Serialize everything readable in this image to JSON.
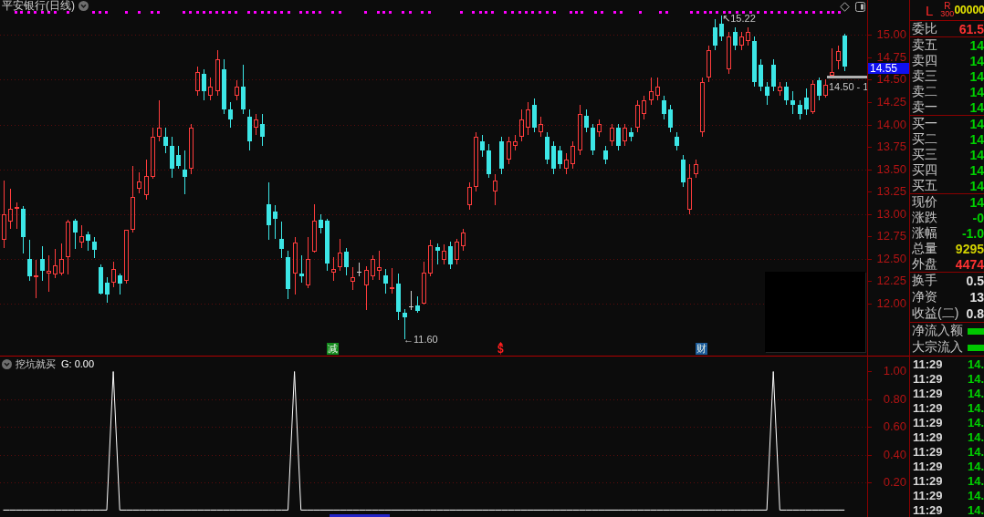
{
  "chart": {
    "title": "平安银行(日线)",
    "current_price": "14.55",
    "high_label": "↖15.22",
    "low_label": "←11.60",
    "price_line_label": "14.50 - 1",
    "event_markers": [
      {
        "kind": "badge",
        "label": "减",
        "color": "#138a1c"
      },
      {
        "kind": "glyph",
        "label": "$",
        "color": "#ff1e1e"
      },
      {
        "kind": "badge",
        "label": "财",
        "color": "#1d5c9a"
      }
    ],
    "chart_data": {
      "type": "candlestick",
      "grid": true,
      "ylim": [
        11.42,
        15.39
      ],
      "yticks": [
        {
          "value": 15,
          "label": "15.00"
        },
        {
          "value": 14.75,
          "label": "14.75"
        },
        {
          "value": 14.5,
          "label": "14.50"
        },
        {
          "value": 14.25,
          "label": "14.25"
        },
        {
          "value": 14,
          "label": "14.00"
        },
        {
          "value": 13.75,
          "label": "13.75"
        },
        {
          "value": 13.5,
          "label": "13.50"
        },
        {
          "value": 13.25,
          "label": "13.25"
        },
        {
          "value": 13,
          "label": "13.00"
        },
        {
          "value": 12.75,
          "label": "12.75"
        },
        {
          "value": 12.5,
          "label": "12.50"
        },
        {
          "value": 12.25,
          "label": "12.25"
        },
        {
          "value": 12,
          "label": "12.00"
        }
      ],
      "categories": [
        null,
        null,
        null,
        null,
        null,
        null,
        null,
        null,
        null,
        null,
        null,
        null,
        null,
        null,
        null,
        null,
        null,
        null,
        null,
        null,
        null,
        null,
        null,
        null,
        null,
        null,
        null,
        null,
        null,
        null,
        null,
        null,
        null,
        null,
        null,
        null,
        null,
        null,
        null,
        null,
        null,
        null,
        null,
        null,
        null,
        null,
        null,
        null,
        null,
        null,
        null,
        null,
        null,
        null,
        null,
        null,
        null,
        null,
        null,
        null,
        null,
        null,
        null,
        null,
        null,
        null,
        null,
        null,
        null,
        null,
        null,
        null,
        null,
        null,
        null,
        null,
        null,
        null,
        null,
        null,
        null,
        null,
        null,
        null,
        null,
        null,
        null,
        null,
        null,
        null,
        null,
        null,
        null,
        null,
        null,
        null,
        null,
        null,
        null,
        null,
        null,
        null,
        null,
        null,
        null,
        null,
        null,
        null,
        null,
        null,
        null,
        null,
        null,
        null,
        null,
        null,
        null,
        null,
        null,
        null,
        null,
        null,
        null,
        null,
        null,
        null,
        null,
        null,
        null,
        null,
        null,
        null,
        null,
        null
      ],
      "ohlc": [
        [
          12.71,
          13.37,
          12.62,
          13.0
        ],
        [
          12.92,
          13.28,
          12.84,
          13.06
        ],
        [
          13.06,
          13.13,
          12.84,
          13.08
        ],
        [
          13.06,
          13.09,
          12.56,
          12.74
        ],
        [
          12.5,
          12.71,
          12.25,
          12.31
        ],
        [
          12.31,
          12.49,
          12.06,
          12.32
        ],
        [
          12.5,
          12.64,
          12.25,
          12.37
        ],
        [
          12.34,
          12.54,
          12.13,
          12.37
        ],
        [
          12.33,
          12.61,
          12.29,
          12.43
        ],
        [
          12.34,
          12.67,
          12.32,
          12.5
        ],
        [
          12.52,
          12.94,
          12.33,
          12.92
        ],
        [
          12.93,
          12.95,
          12.61,
          12.79
        ],
        [
          12.68,
          12.88,
          12.62,
          12.75
        ],
        [
          12.77,
          12.8,
          12.59,
          12.7
        ],
        [
          12.69,
          12.74,
          12.51,
          12.6
        ],
        [
          12.41,
          12.44,
          12.1,
          12.11
        ],
        [
          12.23,
          12.3,
          12.01,
          12.1
        ],
        [
          12.23,
          12.47,
          12.18,
          12.39
        ],
        [
          12.32,
          12.34,
          12.1,
          12.22
        ],
        [
          12.25,
          12.82,
          12.22,
          12.82
        ],
        [
          12.82,
          13.54,
          12.79,
          13.19
        ],
        [
          13.28,
          13.47,
          13.23,
          13.36
        ],
        [
          13.21,
          13.61,
          13.16,
          13.43
        ],
        [
          13.42,
          13.96,
          13.39,
          13.86
        ],
        [
          13.86,
          14.27,
          13.81,
          13.96
        ],
        [
          13.86,
          13.96,
          13.68,
          13.76
        ],
        [
          13.76,
          13.86,
          13.4,
          13.51
        ],
        [
          13.66,
          13.76,
          13.51,
          13.54
        ],
        [
          13.5,
          13.71,
          13.22,
          13.42
        ],
        [
          13.51,
          14.01,
          13.45,
          13.96
        ],
        [
          14.37,
          14.65,
          14.32,
          14.59
        ],
        [
          14.57,
          14.62,
          14.27,
          14.37
        ],
        [
          14.32,
          14.52,
          14.27,
          14.42
        ],
        [
          14.37,
          14.83,
          14.32,
          14.73
        ],
        [
          14.62,
          14.73,
          14.12,
          14.17
        ],
        [
          14.17,
          14.25,
          13.96,
          14.06
        ],
        [
          14.32,
          14.49,
          14.27,
          14.42
        ],
        [
          14.42,
          14.67,
          14.12,
          14.17
        ],
        [
          14.09,
          14.17,
          13.71,
          13.81
        ],
        [
          13.96,
          14.12,
          13.88,
          14.06
        ],
        [
          14.01,
          14.12,
          13.76,
          13.86
        ],
        [
          13.11,
          13.35,
          12.71,
          12.88
        ],
        [
          13.03,
          13.1,
          12.72,
          12.95
        ],
        [
          12.72,
          12.92,
          12.51,
          12.61
        ],
        [
          12.52,
          12.59,
          12.05,
          12.16
        ],
        [
          12.34,
          12.74,
          12.1,
          12.68
        ],
        [
          12.34,
          12.54,
          12.23,
          12.31
        ],
        [
          12.2,
          12.74,
          12.17,
          12.5
        ],
        [
          12.58,
          13.11,
          12.57,
          12.93
        ],
        [
          12.94,
          13.0,
          12.78,
          12.85
        ],
        [
          12.93,
          12.95,
          12.37,
          12.45
        ],
        [
          12.35,
          12.52,
          12.25,
          12.39
        ],
        [
          12.41,
          12.72,
          12.37,
          12.57
        ],
        [
          12.58,
          12.62,
          12.32,
          12.41
        ],
        [
          12.24,
          12.41,
          12.15,
          12.3
        ],
        [
          12.36,
          12.46,
          12.31,
          12.36
        ],
        [
          12.2,
          12.42,
          11.93,
          12.38
        ],
        [
          12.31,
          12.54,
          12.26,
          12.5
        ],
        [
          12.37,
          12.59,
          12.26,
          12.41
        ],
        [
          12.32,
          12.39,
          12.11,
          12.22
        ],
        [
          12.16,
          12.4,
          12.11,
          12.18
        ],
        [
          12.22,
          12.34,
          11.82,
          11.91
        ],
        [
          11.9,
          11.94,
          11.6,
          11.85
        ],
        [
          11.97,
          12.14,
          11.93,
          11.97
        ],
        [
          11.98,
          12.08,
          11.9,
          11.92
        ],
        [
          12.0,
          12.47,
          11.99,
          12.35
        ],
        [
          12.34,
          12.71,
          12.31,
          12.65
        ],
        [
          12.63,
          12.67,
          12.44,
          12.59
        ],
        [
          12.49,
          12.66,
          12.44,
          12.59
        ],
        [
          12.64,
          12.69,
          12.39,
          12.44
        ],
        [
          12.49,
          12.72,
          12.44,
          12.69
        ],
        [
          12.64,
          12.84,
          12.59,
          12.79
        ],
        [
          13.1,
          13.35,
          13.05,
          13.3
        ],
        [
          13.3,
          13.91,
          13.25,
          13.86
        ],
        [
          13.81,
          13.88,
          13.64,
          13.71
        ],
        [
          13.71,
          13.78,
          13.4,
          13.45
        ],
        [
          13.25,
          13.45,
          13.1,
          13.37
        ],
        [
          13.81,
          13.86,
          13.45,
          13.51
        ],
        [
          13.61,
          13.86,
          13.56,
          13.81
        ],
        [
          13.76,
          13.88,
          13.71,
          13.81
        ],
        [
          13.86,
          14.17,
          13.81,
          14.06
        ],
        [
          13.96,
          14.25,
          13.88,
          14.17
        ],
        [
          14.22,
          14.29,
          13.91,
          13.96
        ],
        [
          13.91,
          14.09,
          13.86,
          14.01
        ],
        [
          13.86,
          13.91,
          13.56,
          13.61
        ],
        [
          13.76,
          13.81,
          13.45,
          13.51
        ],
        [
          13.71,
          13.76,
          13.51,
          13.56
        ],
        [
          13.51,
          13.68,
          13.45,
          13.61
        ],
        [
          13.56,
          13.81,
          13.51,
          13.76
        ],
        [
          13.71,
          14.22,
          13.66,
          14.12
        ],
        [
          14.1,
          14.17,
          13.91,
          13.96
        ],
        [
          13.96,
          14.01,
          13.66,
          13.71
        ],
        [
          13.91,
          14.06,
          13.86,
          14.01
        ],
        [
          13.71,
          13.76,
          13.56,
          13.61
        ],
        [
          13.81,
          14.01,
          13.76,
          13.96
        ],
        [
          13.96,
          14.01,
          13.71,
          13.76
        ],
        [
          13.81,
          14.01,
          13.76,
          13.96
        ],
        [
          13.91,
          13.96,
          13.81,
          13.86
        ],
        [
          13.96,
          14.27,
          13.91,
          14.22
        ],
        [
          14.12,
          14.32,
          14.06,
          14.27
        ],
        [
          14.27,
          14.52,
          14.22,
          14.37
        ],
        [
          14.32,
          14.52,
          14.27,
          14.42
        ],
        [
          14.27,
          14.32,
          14.06,
          14.12
        ],
        [
          14.17,
          14.22,
          13.91,
          13.96
        ],
        [
          13.86,
          13.91,
          13.71,
          13.76
        ],
        [
          13.61,
          13.66,
          13.3,
          13.35
        ],
        [
          13.05,
          13.56,
          13.0,
          13.4
        ],
        [
          13.45,
          13.61,
          13.4,
          13.56
        ],
        [
          13.91,
          14.52,
          13.86,
          14.47
        ],
        [
          14.52,
          14.88,
          14.47,
          14.83
        ],
        [
          15.08,
          15.18,
          14.83,
          14.88
        ],
        [
          15.13,
          15.22,
          14.93,
          14.98
        ],
        [
          14.62,
          15.03,
          14.57,
          14.98
        ],
        [
          15.03,
          15.08,
          14.83,
          14.88
        ],
        [
          14.88,
          15.03,
          14.83,
          14.98
        ],
        [
          14.93,
          15.08,
          14.88,
          15.03
        ],
        [
          14.93,
          14.98,
          14.42,
          14.47
        ],
        [
          14.67,
          14.73,
          14.37,
          14.42
        ],
        [
          14.42,
          14.47,
          14.22,
          14.32
        ],
        [
          14.67,
          14.73,
          14.37,
          14.42
        ],
        [
          14.37,
          14.47,
          14.32,
          14.42
        ],
        [
          14.42,
          14.47,
          14.22,
          14.27
        ],
        [
          14.27,
          14.37,
          14.12,
          14.22
        ],
        [
          14.22,
          14.27,
          14.06,
          14.12
        ],
        [
          14.3,
          14.4,
          14.11,
          14.17
        ],
        [
          14.14,
          14.49,
          14.12,
          14.45
        ],
        [
          14.49,
          14.52,
          14.27,
          14.32
        ],
        [
          14.32,
          14.5,
          14.3,
          14.44
        ],
        [
          14.55,
          14.85,
          14.55,
          14.59
        ],
        [
          14.71,
          14.88,
          14.62,
          14.82
        ],
        [
          14.99,
          15.01,
          14.6,
          14.65
        ],
        null,
        null,
        null
      ]
    }
  },
  "indicator": {
    "title": "挖坑就买",
    "reading": ": 0.00",
    "chart_data": {
      "type": "line",
      "grid": true,
      "ylim": [
        -0.05,
        1.115
      ],
      "yticks": [
        {
          "value": 1,
          "label": "1.00"
        },
        {
          "value": 0.8,
          "label": "0.80"
        },
        {
          "value": 0.6,
          "label": "0.60"
        },
        {
          "value": 0.4,
          "label": "0.40"
        },
        {
          "value": 0.2,
          "label": "0.20"
        }
      ],
      "categories": [
        null,
        null,
        null,
        null,
        null,
        null,
        null,
        null,
        null,
        null,
        null,
        null,
        null,
        null,
        null,
        null,
        null,
        null,
        null,
        null,
        null,
        null,
        null,
        null,
        null,
        null,
        null,
        null,
        null,
        null,
        null,
        null,
        null,
        null,
        null,
        null,
        null,
        null,
        null,
        null,
        null,
        null,
        null,
        null,
        null,
        null,
        null,
        null,
        null,
        null,
        null,
        null,
        null,
        null,
        null,
        null,
        null,
        null,
        null,
        null,
        null,
        null,
        null,
        null,
        null,
        null,
        null,
        null,
        null,
        null,
        null,
        null,
        null,
        null,
        null,
        null,
        null,
        null,
        null,
        null,
        null,
        null,
        null,
        null,
        null,
        null,
        null,
        null,
        null,
        null,
        null,
        null,
        null,
        null,
        null,
        null,
        null,
        null,
        null,
        null,
        null,
        null,
        null,
        null,
        null,
        null,
        null,
        null,
        null,
        null,
        null,
        null,
        null,
        null,
        null,
        null,
        null,
        null,
        null,
        null,
        null,
        null,
        null,
        null,
        null,
        null,
        null,
        null,
        null,
        null,
        null,
        null,
        null,
        null
      ],
      "series": [
        {
          "name": "G",
          "color": "#ffffff",
          "values": [
            0,
            0,
            0,
            0,
            0,
            0,
            0,
            0,
            0,
            0,
            0,
            0,
            0,
            0,
            0,
            0,
            0,
            1,
            0,
            0,
            0,
            0,
            0,
            0,
            0,
            0,
            0,
            0,
            0,
            0,
            0,
            0,
            0,
            0,
            0,
            0,
            0,
            0,
            0,
            0,
            0,
            0,
            0,
            0,
            0,
            1,
            0,
            0,
            0,
            0,
            0,
            0,
            0,
            0,
            0,
            0,
            0,
            0,
            0,
            0,
            0,
            0,
            0,
            0,
            0,
            0,
            0,
            0,
            0,
            0,
            0,
            0,
            0,
            0,
            0,
            0,
            0,
            0,
            0,
            0,
            0,
            0,
            0,
            0,
            0,
            0,
            0,
            0,
            0,
            0,
            0,
            0,
            0,
            0,
            0,
            0,
            0,
            0,
            0,
            0,
            0,
            0,
            0,
            0,
            0,
            0,
            0,
            0,
            0,
            0,
            0,
            0,
            0,
            0,
            0,
            0,
            0,
            0,
            0,
            1,
            0,
            0,
            0,
            0,
            0,
            0,
            0,
            0,
            0,
            0,
            0,
            null,
            null,
            null
          ]
        }
      ]
    }
  },
  "quote_panel": {
    "flag": "L",
    "r_label": "R",
    "r_number": "300",
    "code": "00000",
    "ratio": {
      "label": "委比",
      "value": "61.5"
    },
    "asks": [
      {
        "label": "卖五",
        "price": "14"
      },
      {
        "label": "卖四",
        "price": "14"
      },
      {
        "label": "卖三",
        "price": "14"
      },
      {
        "label": "卖二",
        "price": "14"
      },
      {
        "label": "卖一",
        "price": "14"
      }
    ],
    "bids": [
      {
        "label": "买一",
        "price": "14"
      },
      {
        "label": "买二",
        "price": "14"
      },
      {
        "label": "买三",
        "price": "14"
      },
      {
        "label": "买四",
        "price": "14"
      },
      {
        "label": "买五",
        "price": "14"
      }
    ],
    "stats": [
      {
        "label": "现价",
        "value": "14",
        "color": "#00d200"
      },
      {
        "label": "涨跌",
        "value": "-0",
        "color": "#00d200"
      },
      {
        "label": "涨幅",
        "value": "-1.0",
        "color": "#00d200"
      },
      {
        "label": "总量",
        "value": "9295",
        "color": "#d2d200"
      },
      {
        "label": "外盘",
        "value": "4474",
        "color": "#ff3232"
      }
    ],
    "fundamentals": [
      {
        "label": "换手",
        "value": "0.5"
      },
      {
        "label": "净资",
        "value": "13"
      },
      {
        "label": "收益(二)",
        "value": "0.8"
      }
    ],
    "flows": [
      {
        "label": "净流入额"
      },
      {
        "label": "大宗流入"
      }
    ],
    "trades": [
      {
        "time": "11:29",
        "price": "14."
      },
      {
        "time": "11:29",
        "price": "14."
      },
      {
        "time": "11:29",
        "price": "14."
      },
      {
        "time": "11:29",
        "price": "14."
      },
      {
        "time": "11:29",
        "price": "14."
      },
      {
        "time": "11:29",
        "price": "14."
      },
      {
        "time": "11:29",
        "price": "14."
      },
      {
        "time": "11:29",
        "price": "14."
      },
      {
        "time": "11:29",
        "price": "14."
      },
      {
        "time": "11:29",
        "price": "14."
      },
      {
        "time": "11:29",
        "price": "14."
      }
    ]
  }
}
